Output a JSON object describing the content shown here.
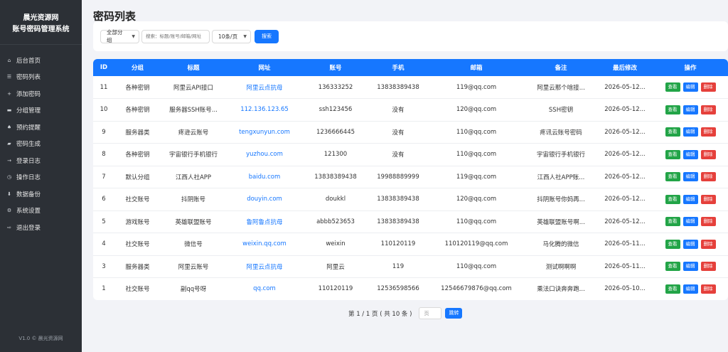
{
  "sidebar": {
    "brand_line1": "晨光资源网",
    "brand_line2": "账号密码管理系统",
    "items": [
      {
        "label": "后台首页",
        "icon": "⌂"
      },
      {
        "label": "密码列表",
        "icon": "☰"
      },
      {
        "label": "添加密码",
        "icon": "+"
      },
      {
        "label": "分组管理",
        "icon": "▬"
      },
      {
        "label": "预约提醒",
        "icon": "♠"
      },
      {
        "label": "密码生成",
        "icon": "▰"
      },
      {
        "label": "登录日志",
        "icon": "→"
      },
      {
        "label": "操作日志",
        "icon": "◷"
      },
      {
        "label": "数据备份",
        "icon": "⬇"
      },
      {
        "label": "系统设置",
        "icon": "⚙"
      },
      {
        "label": "退出登录",
        "icon": "⇨"
      }
    ],
    "footer": "V1.0 © 晨光资源网"
  },
  "page_title": "密码列表",
  "filter": {
    "group_select": "全部分组",
    "search_placeholder": "搜索：标题/账号/邮箱/网址",
    "per_page": "10条/页",
    "search_button": "搜索"
  },
  "table": {
    "headers": [
      "ID",
      "分组",
      "标题",
      "网址",
      "账号",
      "手机",
      "邮箱",
      "备注",
      "最后修改",
      "操作"
    ],
    "buttons": {
      "view": "查看",
      "edit": "编辑",
      "delete": "删除"
    },
    "rows": [
      [
        "11",
        "各种密钥",
        "阿里云API接口",
        "阿里云点抗母",
        "136333252",
        "13838389438",
        "119@qq.com",
        "阿里云那个啥接...",
        "2026-05-12..."
      ],
      [
        "10",
        "各种密钥",
        "服务器SSH账号...",
        "112.136.123.65",
        "ssh123456",
        "没有",
        "120@qq.com",
        "SSH密钥",
        "2026-05-12..."
      ],
      [
        "9",
        "服务器类",
        "疼逊云账号",
        "tengxunyun.com",
        "1236666445",
        "没有",
        "110@qq.com",
        "疼讯云账号密码",
        "2026-05-12..."
      ],
      [
        "8",
        "各种密钥",
        "宇宙银行手机银行",
        "yuzhou.com",
        "121300",
        "没有",
        "110@qq.com",
        "宇宙银行手机银行",
        "2026-05-12..."
      ],
      [
        "7",
        "默认分组",
        "江西人社APP",
        "baidu.com",
        "13838389438",
        "19988889999",
        "119@qq.com",
        "江西人社APP账...",
        "2026-05-12..."
      ],
      [
        "6",
        "社交账号",
        "抖阴账号",
        "douyin.com",
        "doukkl",
        "13838389438",
        "120@qq.com",
        "抖阴账号你妈再...",
        "2026-05-12..."
      ],
      [
        "5",
        "游戏账号",
        "英雄联盟账号",
        "鲁阿鲁点抗母",
        "abbb523653",
        "13838389438",
        "110@qq.com",
        "英雄联盟账号啊...",
        "2026-05-12..."
      ],
      [
        "4",
        "社交账号",
        "微信号",
        "weixin.qq.com",
        "weixin",
        "110120119",
        "110120119@qq.com",
        "马化腾的微信",
        "2026-05-11..."
      ],
      [
        "3",
        "服务器类",
        "阿里云账号",
        "阿里云点抗母",
        "阿里云",
        "119",
        "110@qq.com",
        "测试啊啊啊",
        "2026-05-11..."
      ],
      [
        "1",
        "社交账号",
        "副qq号呀",
        "qq.com",
        "110120119",
        "12536598566",
        "12546679876@qq.com",
        "乘法口诀奔奔跑...",
        "2026-05-10..."
      ]
    ]
  },
  "pager": {
    "info": "第 1 / 1 页 ( 共 10 条 )",
    "page_placeholder": "页",
    "go_button": "跳转"
  },
  "colors": {
    "sidebar_bg": "#2c3036",
    "accent": "#1677ff",
    "view": "#22a447",
    "delete": "#e5403b",
    "page_bg": "#f2f3f7"
  }
}
